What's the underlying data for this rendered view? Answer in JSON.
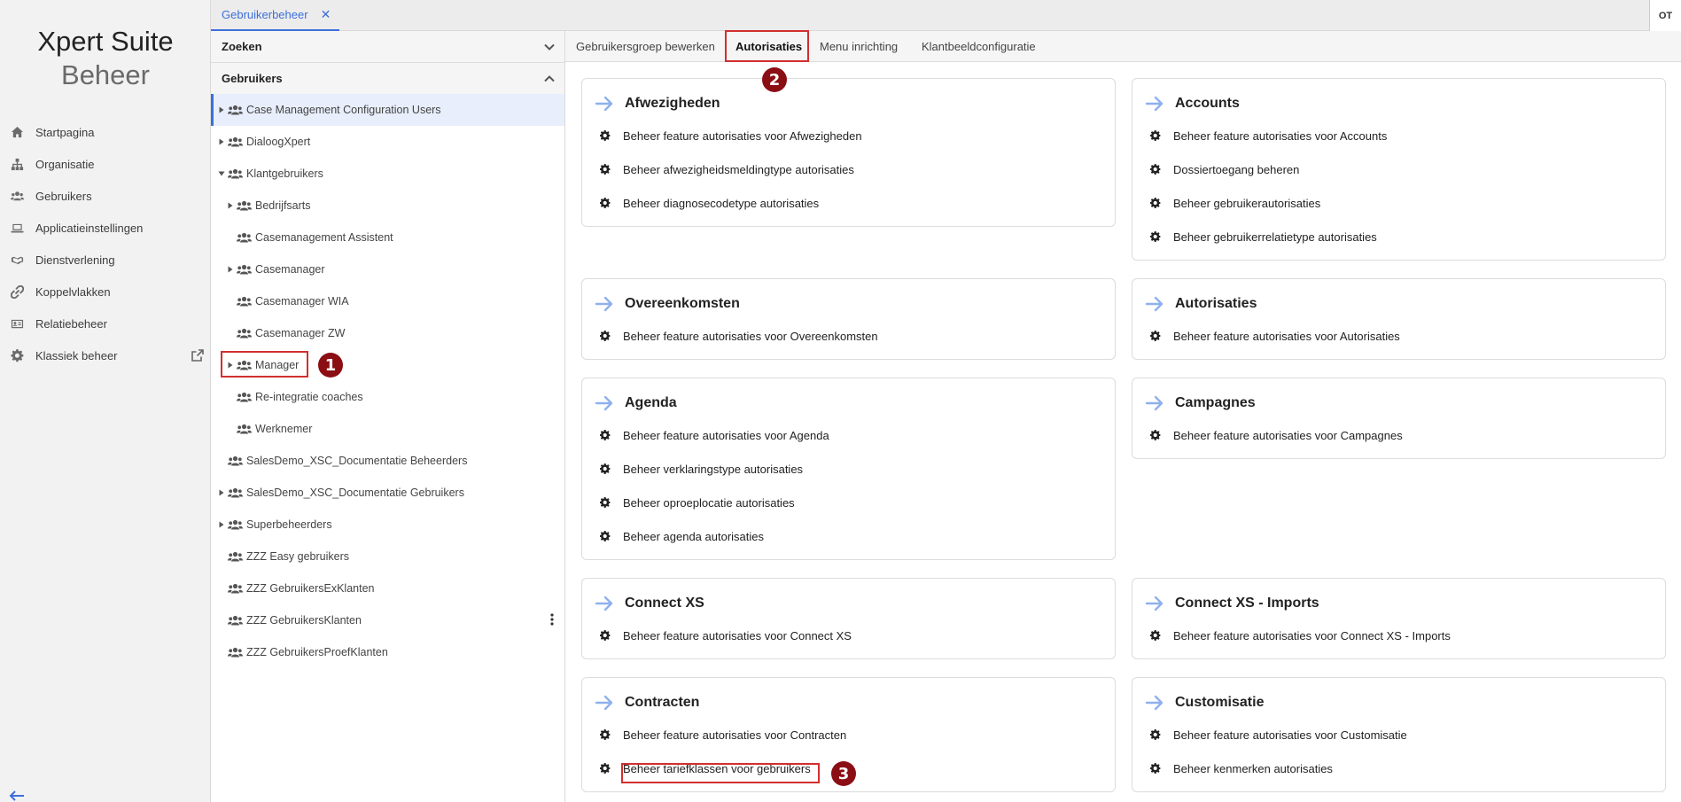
{
  "app": {
    "title_line1": "Xpert Suite",
    "title_line2": "Beheer"
  },
  "nav": {
    "items": [
      {
        "label": "Startpagina",
        "icon": "home-icon"
      },
      {
        "label": "Organisatie",
        "icon": "sitemap-icon"
      },
      {
        "label": "Gebruikers",
        "icon": "users-icon"
      },
      {
        "label": "Applicatieinstellingen",
        "icon": "laptop-icon"
      },
      {
        "label": "Dienstverlening",
        "icon": "handshake-icon"
      },
      {
        "label": "Koppelvlakken",
        "icon": "link-icon"
      },
      {
        "label": "Relatiebeheer",
        "icon": "id-card-icon"
      },
      {
        "label": "Klassiek beheer",
        "icon": "gear-icon"
      }
    ]
  },
  "tabs": {
    "active_label": "Gebruikerbeheer",
    "close_symbol": "✕",
    "avatar_initials": "OT"
  },
  "tree": {
    "search_header": "Zoeken",
    "users_header": "Gebruikers",
    "rows": [
      {
        "label": "Case Management Configuration Users",
        "expander": "collapsed",
        "level": 0,
        "selected": true
      },
      {
        "label": "DialoogXpert",
        "expander": "collapsed",
        "level": 0
      },
      {
        "label": "Klantgebruikers",
        "expander": "expanded",
        "level": 0
      },
      {
        "label": "Bedrijfsarts",
        "expander": "collapsed",
        "level": 1
      },
      {
        "label": "Casemanagement Assistent",
        "expander": "none",
        "level": 1
      },
      {
        "label": "Casemanager",
        "expander": "collapsed",
        "level": 1
      },
      {
        "label": "Casemanager WIA",
        "expander": "none",
        "level": 1
      },
      {
        "label": "Casemanager ZW",
        "expander": "none",
        "level": 1
      },
      {
        "label": "Manager",
        "expander": "collapsed",
        "level": 1,
        "highlight": true
      },
      {
        "label": "Re-integratie coaches",
        "expander": "none",
        "level": 1
      },
      {
        "label": "Werknemer",
        "expander": "none",
        "level": 1
      },
      {
        "label": "SalesDemo_XSC_Documentatie Beheerders",
        "expander": "none",
        "level": 0
      },
      {
        "label": "SalesDemo_XSC_Documentatie Gebruikers",
        "expander": "collapsed",
        "level": 0
      },
      {
        "label": "Superbeheerders",
        "expander": "collapsed",
        "level": 0
      },
      {
        "label": "ZZZ Easy gebruikers",
        "expander": "none",
        "level": 0
      },
      {
        "label": "ZZZ GebruikersExKlanten",
        "expander": "none",
        "level": 0
      },
      {
        "label": "ZZZ GebruikersKlanten",
        "expander": "none",
        "level": 0,
        "menu": true
      },
      {
        "label": "ZZZ GebruikersProefKlanten",
        "expander": "none",
        "level": 0
      }
    ]
  },
  "sub_tabs": [
    {
      "label": "Gebruikersgroep bewerken",
      "active": false
    },
    {
      "label": "Autorisaties",
      "active": true
    },
    {
      "label": "Menu inrichting",
      "active": false
    },
    {
      "label": "Klantbeeldconfiguratie",
      "active": false
    }
  ],
  "cards": [
    {
      "title": "Afwezigheden",
      "links": [
        "Beheer feature autorisaties voor Afwezigheden",
        "Beheer afwezigheidsmeldingtype autorisaties",
        "Beheer diagnosecodetype autorisaties"
      ]
    },
    {
      "title": "Accounts",
      "links": [
        "Beheer feature autorisaties voor Accounts",
        "Dossiertoegang beheren",
        "Beheer gebruikerautorisaties",
        "Beheer gebruikerrelatietype autorisaties"
      ]
    },
    {
      "title": "Overeenkomsten",
      "links": [
        "Beheer feature autorisaties voor Overeenkomsten"
      ]
    },
    {
      "title": "Autorisaties",
      "links": [
        "Beheer feature autorisaties voor Autorisaties"
      ]
    },
    {
      "title": "Agenda",
      "links": [
        "Beheer feature autorisaties voor Agenda",
        "Beheer verklaringstype autorisaties",
        "Beheer oproeplocatie autorisaties",
        "Beheer agenda autorisaties"
      ]
    },
    {
      "title": "Campagnes",
      "links": [
        "Beheer feature autorisaties voor Campagnes"
      ]
    },
    {
      "title": "Connect XS",
      "links": [
        "Beheer feature autorisaties voor Connect XS"
      ]
    },
    {
      "title": "Connect XS - Imports",
      "links": [
        "Beheer feature autorisaties voor Connect XS - Imports"
      ]
    },
    {
      "title": "Contracten",
      "links": [
        "Beheer feature autorisaties voor Contracten",
        "Beheer tariefklassen voor gebruikers"
      ]
    },
    {
      "title": "Customisatie",
      "links": [
        "Beheer feature autorisaties voor Customisatie",
        "Beheer kenmerken autorisaties"
      ]
    }
  ],
  "annotations": {
    "step1": "1",
    "step2": "2",
    "step3": "3"
  },
  "colors": {
    "accent": "#3d6fd9",
    "highlight": "#d32f2f",
    "badge": "#8b0e14",
    "arrow": "#8fb0ee"
  }
}
